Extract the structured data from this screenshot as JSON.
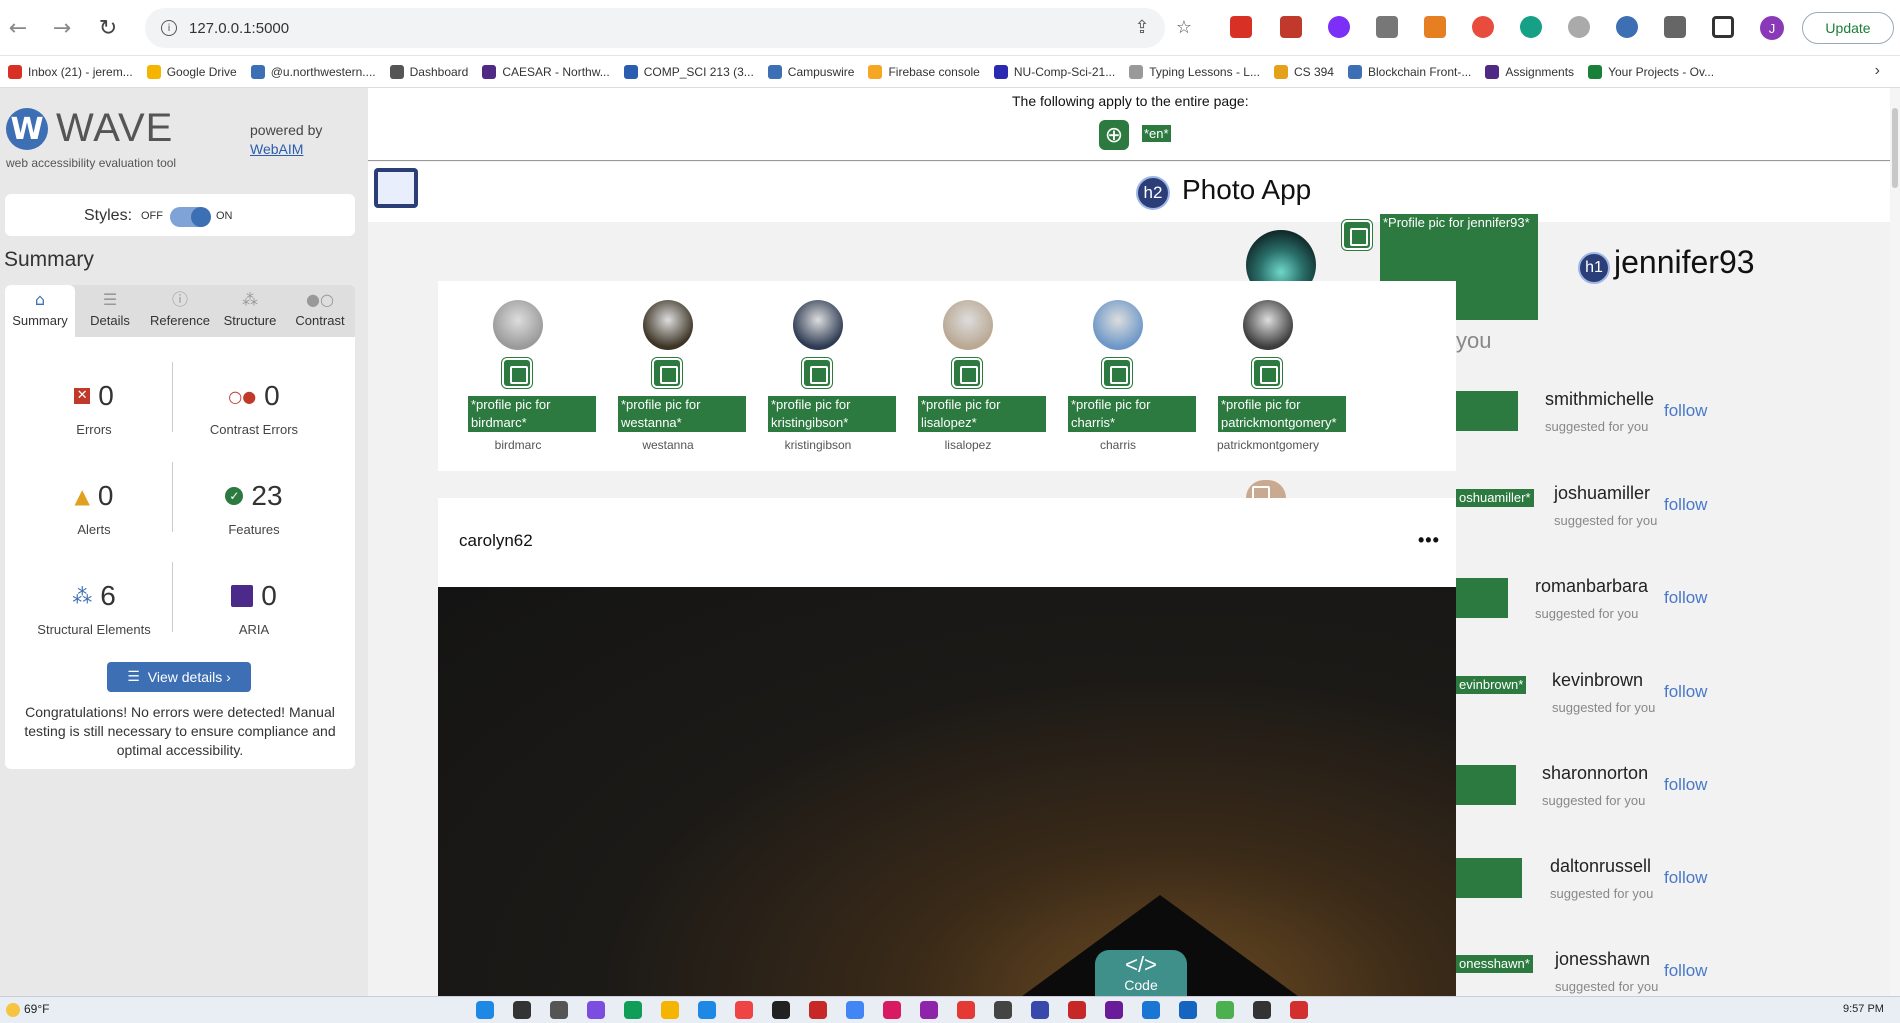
{
  "browser": {
    "url": "127.0.0.1:5000",
    "update_label": "Update",
    "profile_initial": "J",
    "bookmarks": [
      {
        "label": "Inbox (21) - jerem...",
        "color": "#d93025"
      },
      {
        "label": "Google Drive",
        "color": "#f4b400"
      },
      {
        "label": "@u.northwestern....",
        "color": "#3d6fb4"
      },
      {
        "label": "Dashboard",
        "color": "#555555"
      },
      {
        "label": "CAESAR - Northw...",
        "color": "#4e2a84"
      },
      {
        "label": "COMP_SCI 213 (3...",
        "color": "#2a5db0"
      },
      {
        "label": "Campuswire",
        "color": "#3d6fb4"
      },
      {
        "label": "Firebase console",
        "color": "#f5a623"
      },
      {
        "label": "NU-Comp-Sci-21...",
        "color": "#2a2ab0"
      },
      {
        "label": "Typing Lessons - L...",
        "color": "#999999"
      },
      {
        "label": "CS 394",
        "color": "#e3a21a"
      },
      {
        "label": "Blockchain Front-...",
        "color": "#3d6fb4"
      },
      {
        "label": "Assignments",
        "color": "#4e2a84"
      },
      {
        "label": "Your Projects - Ov...",
        "color": "#1a7f37"
      }
    ]
  },
  "wave": {
    "title": "WAVE",
    "subtitle": "web accessibility evaluation tool",
    "powered_by": "powered by",
    "webaim": "WebAIM",
    "styles_label": "Styles:",
    "off_label": "OFF",
    "on_label": "ON",
    "summary_heading": "Summary",
    "tabs": [
      "Summary",
      "Details",
      "Reference",
      "Structure",
      "Contrast"
    ],
    "stats": {
      "errors": {
        "value": "0",
        "label": "Errors"
      },
      "contrast": {
        "value": "0",
        "label": "Contrast Errors"
      },
      "alerts": {
        "value": "0",
        "label": "Alerts"
      },
      "features": {
        "value": "23",
        "label": "Features"
      },
      "structural": {
        "value": "6",
        "label": "Structural Elements"
      },
      "aria": {
        "value": "0",
        "label": "ARIA"
      }
    },
    "view_details": "View details ›",
    "congrats": "Congratulations! No errors were detected! Manual testing is still necessary to ensure compliance and optimal accessibility."
  },
  "page": {
    "entire_page_text": "The following apply to the entire page:",
    "lang_tag": "*en*",
    "h2_badge": "h2",
    "app_title": "Photo App",
    "h1_badge": "h1",
    "me_name": "jennifer93",
    "me_alt": "*Profile pic for jennifer93*",
    "suggestions_partial": "you",
    "stories": [
      {
        "alt": "*profile pic for birdmarc*",
        "name": "birdmarc",
        "color": "#9a9a9a"
      },
      {
        "alt": "*profile pic for westanna*",
        "name": "westanna",
        "color": "#3b3324"
      },
      {
        "alt": "*profile pic for kristingibson*",
        "name": "kristingibson",
        "color": "#2d3a52"
      },
      {
        "alt": "*profile pic for lisalopez*",
        "name": "lisalopez",
        "color": "#b9a892"
      },
      {
        "alt": "*profile pic for charris*",
        "name": "charris",
        "color": "#6c97c8"
      },
      {
        "alt": "*profile pic for patrickmontgomery*",
        "name": "patrickmontgomery",
        "color": "#3c3c3c"
      }
    ],
    "suggestions": [
      {
        "name": "smithmichelle",
        "sub": "suggested for you",
        "follow": "follow",
        "alt": ""
      },
      {
        "name": "joshuamiller",
        "sub": "suggested for you",
        "follow": "follow",
        "alt": "oshuamiller*"
      },
      {
        "name": "romanbarbara",
        "sub": "suggested for you",
        "follow": "follow",
        "alt": ""
      },
      {
        "name": "kevinbrown",
        "sub": "suggested for you",
        "follow": "follow",
        "alt": "evinbrown*"
      },
      {
        "name": "sharonnorton",
        "sub": "suggested for you",
        "follow": "follow",
        "alt": ""
      },
      {
        "name": "daltonrussell",
        "sub": "suggested for you",
        "follow": "follow",
        "alt": ""
      },
      {
        "name": "jonesshawn",
        "sub": "suggested for you",
        "follow": "follow",
        "alt": "onesshawn*"
      }
    ],
    "post_user": "carolyn62",
    "post_more": "•••",
    "code_label": "Code",
    "code_icon": "</>"
  },
  "taskbar": {
    "weather": "69°F",
    "clock": "9:57 PM"
  }
}
